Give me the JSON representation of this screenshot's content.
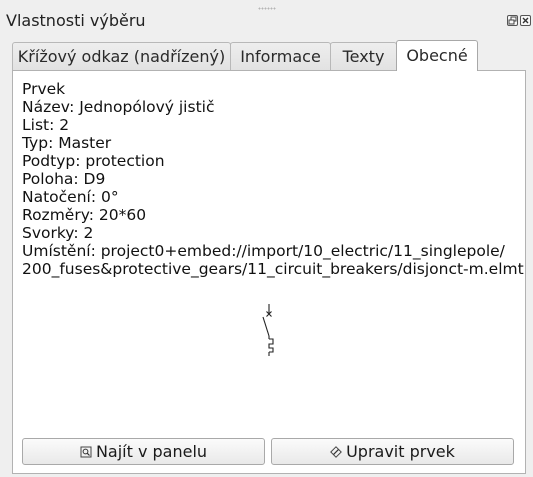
{
  "window": {
    "title": "Vlastnosti výběru"
  },
  "tabs": [
    {
      "label": "Křížový odkaz (nadřízený)",
      "active": false
    },
    {
      "label": "Informace",
      "active": false
    },
    {
      "label": "Texty",
      "active": false
    },
    {
      "label": "Obecné",
      "active": true
    }
  ],
  "element": {
    "heading": "Prvek",
    "name_line": "Název: Jednopólový jistič",
    "sheet_line": "List: 2",
    "type_line": "Typ: Master",
    "subtype_line": "Podtyp: protection",
    "position_line": "Poloha: D9",
    "rotation_line": "Natočení: 0°",
    "size_line": "Rozměry: 20*60",
    "terminals_line": "Svorky: 2",
    "location_line_1": "Umístění: project0+embed://import/10_electric/11_singlepole/",
    "location_line_2": "200_fuses&protective_gears/11_circuit_breakers/disjonct-m.elmt"
  },
  "buttons": {
    "find_label": "Najít v panelu",
    "edit_label": "Upravit prvek"
  },
  "icons": {
    "float": "float-icon",
    "close": "close-icon",
    "find": "find-in-panel-icon",
    "edit": "edit-element-icon",
    "symbol": "circuit-breaker-symbol"
  }
}
